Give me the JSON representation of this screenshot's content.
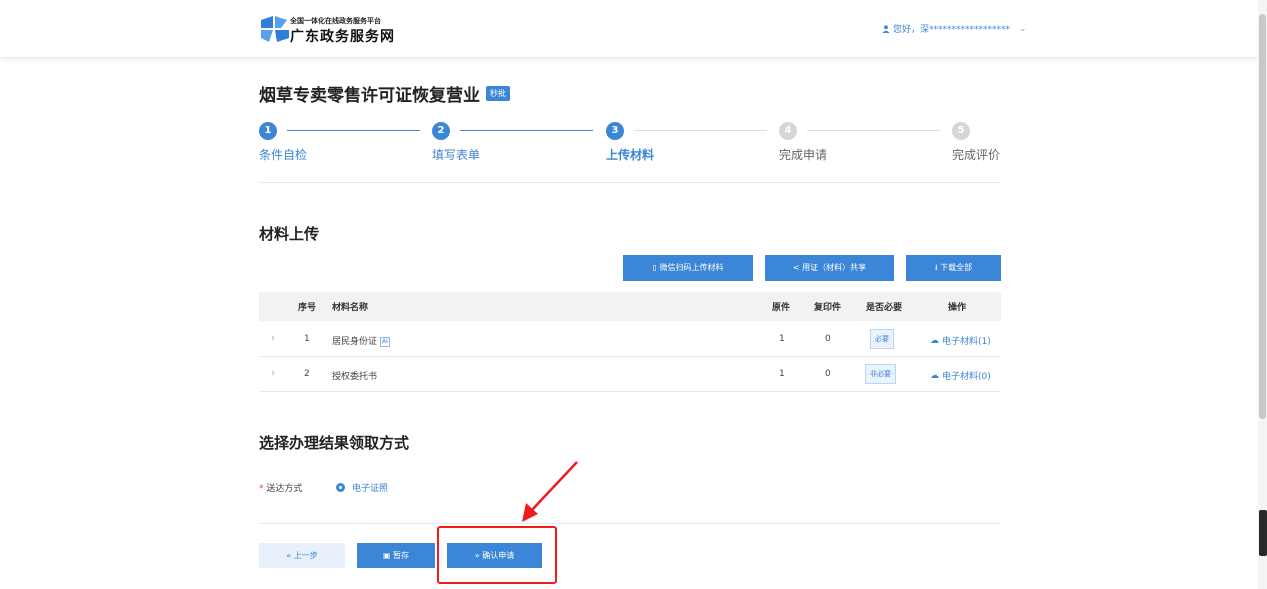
{
  "header": {
    "brand_sub": "全国一体化在线政务服务平台",
    "brand_main": "广东政务服务网",
    "user_greeting": "您好，深******************"
  },
  "page": {
    "title": "烟草专卖零售许可证恢复营业",
    "badge": "秒批"
  },
  "steps": [
    {
      "num": "1",
      "label": "条件自检",
      "state": "done"
    },
    {
      "num": "2",
      "label": "填写表单",
      "state": "done"
    },
    {
      "num": "3",
      "label": "上传材料",
      "state": "current"
    },
    {
      "num": "4",
      "label": "完成申请",
      "state": "todo"
    },
    {
      "num": "5",
      "label": "完成评价",
      "state": "todo"
    }
  ],
  "materials": {
    "section_title": "材料上传",
    "actions": {
      "wechat_upload": "微信扫码上传材料",
      "share": "用证（材料）共享",
      "download_all": "下载全部"
    },
    "columns": {
      "index": "序号",
      "name": "材料名称",
      "original": "原件",
      "copy": "复印件",
      "required": "是否必要",
      "operation": "操作"
    },
    "rows": [
      {
        "index": "1",
        "name": "居民身份证",
        "ai": "AI",
        "original": "1",
        "copy": "0",
        "required": "必要",
        "operation": "电子材料(1)"
      },
      {
        "index": "2",
        "name": "授权委托书",
        "original": "1",
        "copy": "0",
        "required": "非必要",
        "operation": "电子材料(0)"
      }
    ]
  },
  "delivery": {
    "section_title": "选择办理结果领取方式",
    "label_req": "*",
    "label": "送达方式",
    "option": "电子证照"
  },
  "footer_buttons": {
    "prev": "« 上一步",
    "save": "暂存",
    "confirm": "» 确认申请"
  },
  "colors": {
    "primary": "#3b86d6",
    "annotation": "#ee1c1c"
  }
}
